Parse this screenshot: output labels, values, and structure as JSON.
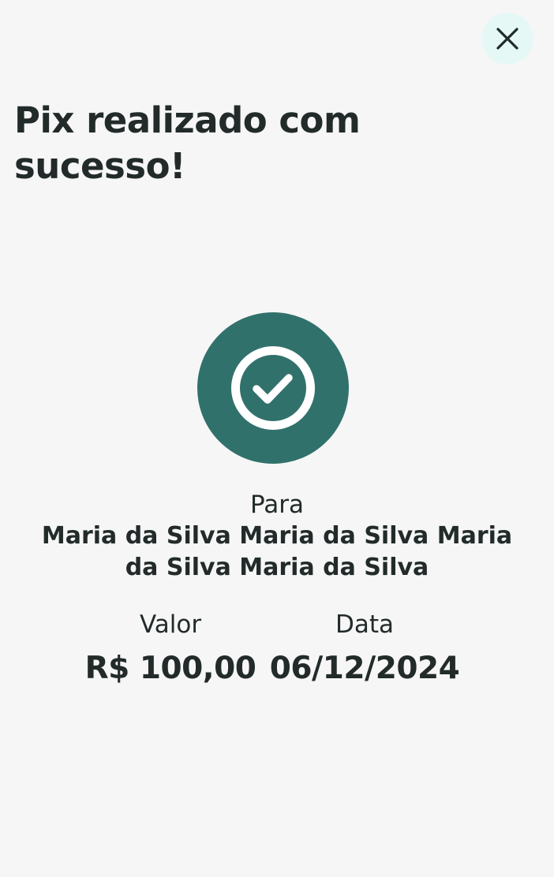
{
  "header": {
    "close_icon": "close-icon"
  },
  "title": "Pix realizado com sucesso!",
  "status": {
    "icon": "check-circle-icon",
    "badge_color": "#31716c"
  },
  "recipient": {
    "label": "Para",
    "name": "Maria da Silva Maria da Silva Maria da Silva Maria da Silva"
  },
  "details": {
    "value_label": "Valor",
    "value": "R$ 100,00",
    "date_label": "Data",
    "date": "06/12/2024"
  },
  "colors": {
    "background": "#f6f6f6",
    "text": "#222b2a",
    "accent": "#31716c",
    "close_button_bg": "#e6f8f6"
  }
}
